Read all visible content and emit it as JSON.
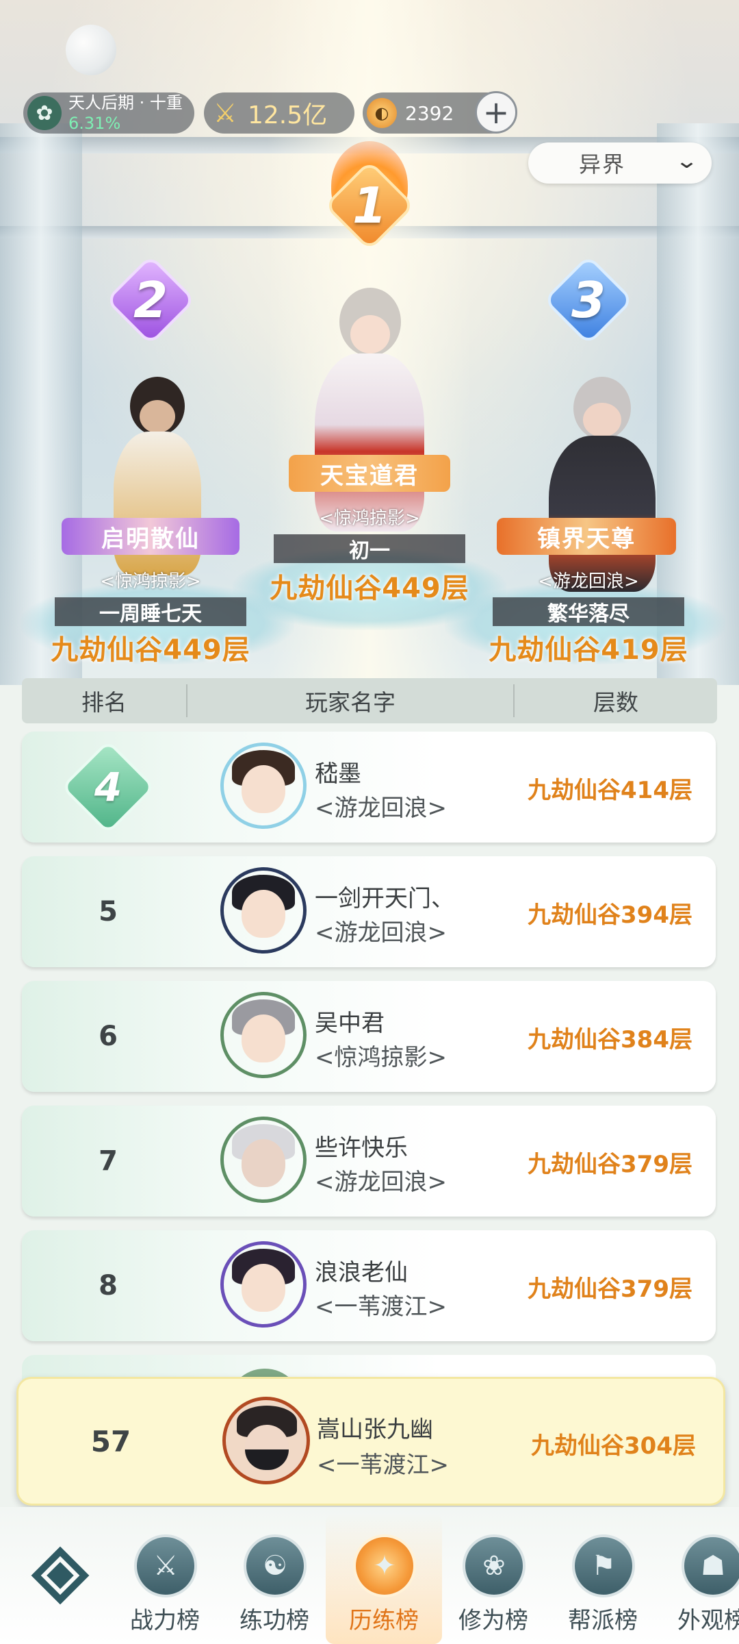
{
  "status": {
    "realm_line": "天人后期 · 十重",
    "realm_progress": "6.31%",
    "combat_power": "12.5亿",
    "jade_amount": "2392"
  },
  "realm_dropdown": {
    "selected": "异界"
  },
  "podium": {
    "first": {
      "rank": "1",
      "title": "天宝道君",
      "guild": "<惊鸿掠影>",
      "name": "初一",
      "floor": "九劫仙谷449层"
    },
    "second": {
      "rank": "2",
      "title": "启明散仙",
      "guild": "<惊鸿掠影>",
      "name": "一周睡七天",
      "floor": "九劫仙谷449层"
    },
    "third": {
      "rank": "3",
      "title": "镇界天尊",
      "guild": "<游龙回浪>",
      "name": "繁华落尽",
      "floor": "九劫仙谷419层"
    }
  },
  "table": {
    "headers": {
      "rank": "排名",
      "player": "玩家名字",
      "floor": "层数"
    },
    "rows": [
      {
        "rank": "4",
        "name": "嵇墨",
        "guild": "<游龙回浪>",
        "floor": "九劫仙谷414层"
      },
      {
        "rank": "5",
        "name": "一剑开天门、",
        "guild": "<游龙回浪>",
        "floor": "九劫仙谷394层"
      },
      {
        "rank": "6",
        "name": "吴中君",
        "guild": "<惊鸿掠影>",
        "floor": "九劫仙谷384层"
      },
      {
        "rank": "7",
        "name": "些许快乐",
        "guild": "<游龙回浪>",
        "floor": "九劫仙谷379层"
      },
      {
        "rank": "8",
        "name": "浪浪老仙",
        "guild": "<一苇渡江>",
        "floor": "九劫仙谷379层"
      }
    ]
  },
  "my_rank": {
    "rank": "57",
    "name": "嵩山张九幽",
    "guild": "<一苇渡江>",
    "floor": "九劫仙谷304层"
  },
  "nav": {
    "tabs": [
      {
        "label": "战力榜",
        "icon": "crossed-swords-icon"
      },
      {
        "label": "练功榜",
        "icon": "yin-yang-icon"
      },
      {
        "label": "历练榜",
        "icon": "star-burst-icon",
        "active": true
      },
      {
        "label": "修为榜",
        "icon": "lotus-icon"
      },
      {
        "label": "帮派榜",
        "icon": "banner-icon"
      },
      {
        "label": "外观榜",
        "icon": "mask-icon"
      }
    ]
  },
  "colors": {
    "accent": "#e0821b",
    "gold_text": "#e58a1a",
    "row_green": "#dff1e7",
    "highlight_row": "#fdf8d2"
  }
}
